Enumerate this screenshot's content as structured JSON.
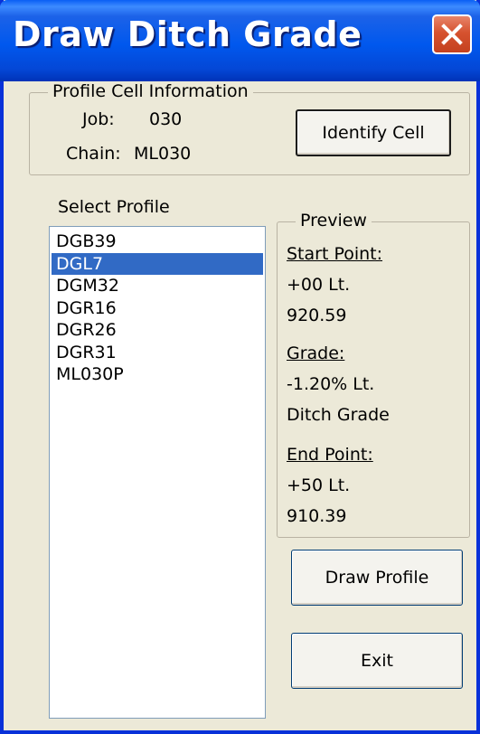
{
  "window": {
    "title": "Draw Ditch Grade"
  },
  "profile_info": {
    "legend": "Profile Cell Information",
    "job_label": "Job:",
    "job_value": "030",
    "chain_label": "Chain:",
    "chain_value": "ML030",
    "identify_button": "Identify Cell"
  },
  "select_profile": {
    "label": "Select Profile",
    "items": [
      {
        "label": "DGB39",
        "selected": false
      },
      {
        "label": "DGL7",
        "selected": true
      },
      {
        "label": "DGM32",
        "selected": false
      },
      {
        "label": "DGR16",
        "selected": false
      },
      {
        "label": "DGR26",
        "selected": false
      },
      {
        "label": "DGR31",
        "selected": false
      },
      {
        "label": "ML030P",
        "selected": false
      }
    ]
  },
  "preview": {
    "legend": "Preview",
    "start_point_label": "Start Point:",
    "start_station": "+00 Lt.",
    "start_elevation": "920.59",
    "grade_label": "Grade:",
    "grade_value": "-1.20% Lt.",
    "grade_type": "Ditch Grade",
    "end_point_label": "End Point:",
    "end_station": "+50 Lt.",
    "end_elevation": "910.39"
  },
  "buttons": {
    "draw_profile": "Draw Profile",
    "exit": "Exit"
  },
  "colors": {
    "title_bar": "#0058ee",
    "selection": "#316ac5",
    "dialog_bg": "#ece9d8",
    "close_button": "#d6522f"
  }
}
